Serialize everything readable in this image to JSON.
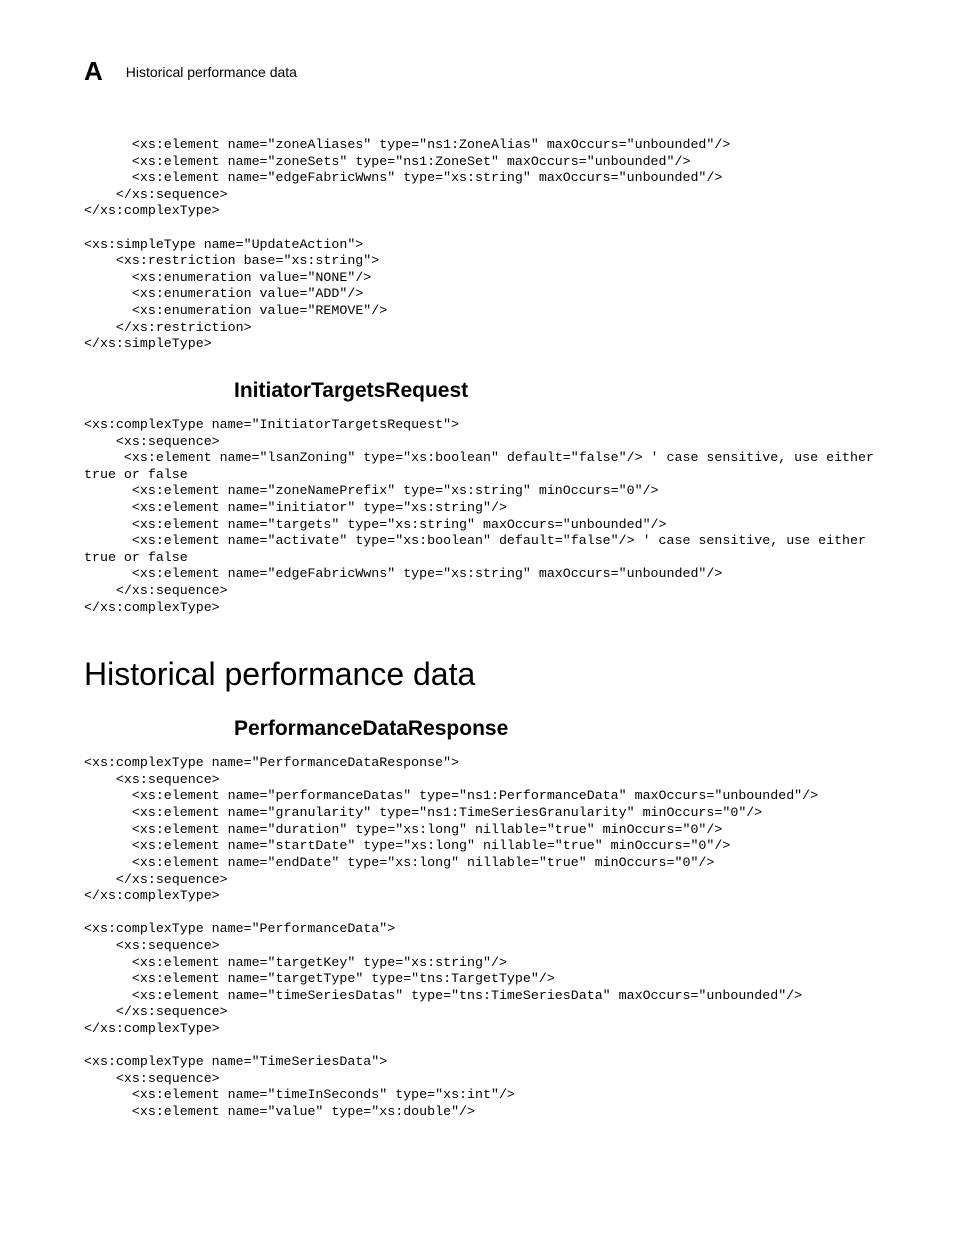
{
  "header": {
    "letter": "A",
    "title": "Historical performance data"
  },
  "code1": "      <xs:element name=\"zoneAliases\" type=\"ns1:ZoneAlias\" maxOccurs=\"unbounded\"/>\n      <xs:element name=\"zoneSets\" type=\"ns1:ZoneSet\" maxOccurs=\"unbounded\"/>\n      <xs:element name=\"edgeFabricWwns\" type=\"xs:string\" maxOccurs=\"unbounded\"/>\n    </xs:sequence>\n</xs:complexType>\n\n<xs:simpleType name=\"UpdateAction\">\n    <xs:restriction base=\"xs:string\">\n      <xs:enumeration value=\"NONE\"/>\n      <xs:enumeration value=\"ADD\"/>\n      <xs:enumeration value=\"REMOVE\"/>\n    </xs:restriction>\n</xs:simpleType>",
  "heading_itr": "InitiatorTargetsRequest",
  "code2": "<xs:complexType name=\"InitiatorTargetsRequest\">\n    <xs:sequence>\n     <xs:element name=\"lsanZoning\" type=\"xs:boolean\" default=\"false\"/> ' case sensitive, use either true or false\n      <xs:element name=\"zoneNamePrefix\" type=\"xs:string\" minOccurs=\"0\"/>\n      <xs:element name=\"initiator\" type=\"xs:string\"/>\n      <xs:element name=\"targets\" type=\"xs:string\" maxOccurs=\"unbounded\"/>\n      <xs:element name=\"activate\" type=\"xs:boolean\" default=\"false\"/> ' case sensitive, use either true or false\n      <xs:element name=\"edgeFabricWwns\" type=\"xs:string\" maxOccurs=\"unbounded\"/>\n    </xs:sequence>\n</xs:complexType>",
  "heading_hpd": "Historical performance data",
  "heading_pdr": "PerformanceDataResponse",
  "code3": "<xs:complexType name=\"PerformanceDataResponse\">\n    <xs:sequence>\n      <xs:element name=\"performanceDatas\" type=\"ns1:PerformanceData\" maxOccurs=\"unbounded\"/>\n      <xs:element name=\"granularity\" type=\"ns1:TimeSeriesGranularity\" minOccurs=\"0\"/>\n      <xs:element name=\"duration\" type=\"xs:long\" nillable=\"true\" minOccurs=\"0\"/>\n      <xs:element name=\"startDate\" type=\"xs:long\" nillable=\"true\" minOccurs=\"0\"/>\n      <xs:element name=\"endDate\" type=\"xs:long\" nillable=\"true\" minOccurs=\"0\"/>\n    </xs:sequence>\n</xs:complexType>\n\n<xs:complexType name=\"PerformanceData\">\n    <xs:sequence>\n      <xs:element name=\"targetKey\" type=\"xs:string\"/>\n      <xs:element name=\"targetType\" type=\"tns:TargetType\"/>\n      <xs:element name=\"timeSeriesDatas\" type=\"tns:TimeSeriesData\" maxOccurs=\"unbounded\"/>\n    </xs:sequence>\n</xs:complexType>\n\n<xs:complexType name=\"TimeSeriesData\">\n    <xs:sequence>\n      <xs:element name=\"timeInSeconds\" type=\"xs:int\"/>\n      <xs:element name=\"value\" type=\"xs:double\"/>"
}
